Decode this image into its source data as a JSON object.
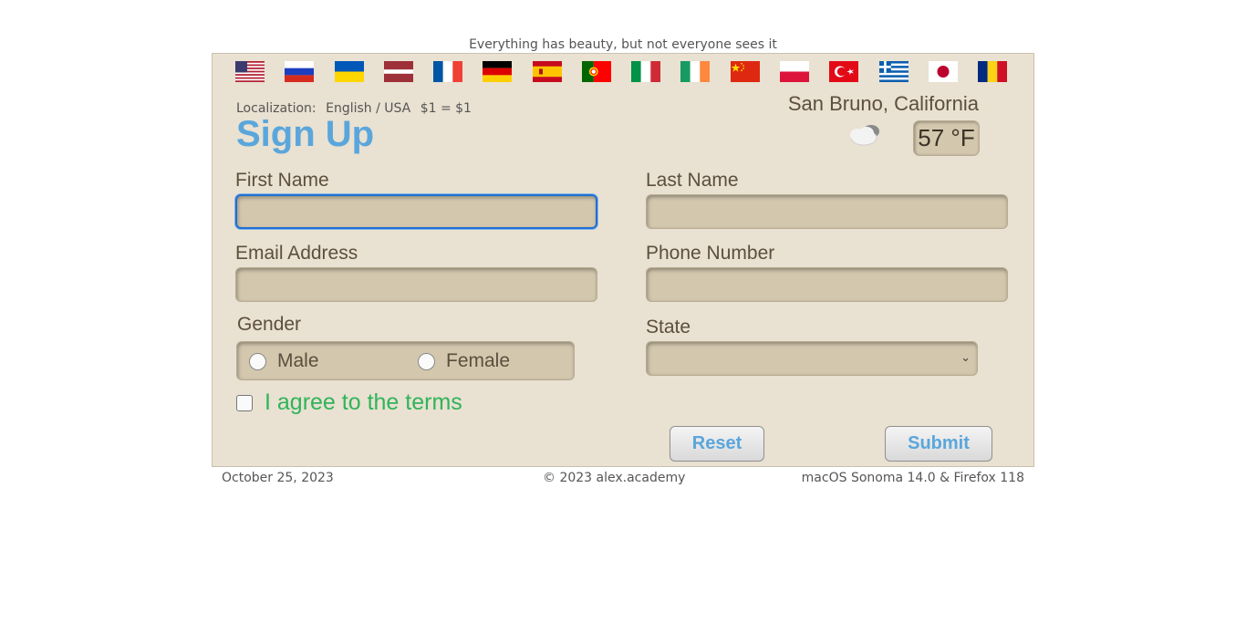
{
  "tagline": "Everything has beauty, but not everyone sees it",
  "flags": [
    {
      "name": "flag-usa"
    },
    {
      "name": "flag-russia"
    },
    {
      "name": "flag-ukraine"
    },
    {
      "name": "flag-latvia"
    },
    {
      "name": "flag-france"
    },
    {
      "name": "flag-germany"
    },
    {
      "name": "flag-spain"
    },
    {
      "name": "flag-portugal"
    },
    {
      "name": "flag-italy"
    },
    {
      "name": "flag-ireland"
    },
    {
      "name": "flag-china"
    },
    {
      "name": "flag-poland"
    },
    {
      "name": "flag-turkey"
    },
    {
      "name": "flag-greece"
    },
    {
      "name": "flag-japan"
    },
    {
      "name": "flag-romania"
    }
  ],
  "localization": {
    "label": "Localization:",
    "value": "English / USA",
    "currency": "$1 = $1"
  },
  "form_title": "Sign Up",
  "weather": {
    "city": "San Bruno, California",
    "icon": "cloud-icon",
    "temperature": "57 °F"
  },
  "fields": {
    "first_name": {
      "label": "First Name",
      "value": ""
    },
    "last_name": {
      "label": "Last Name",
      "value": ""
    },
    "email": {
      "label": "Email Address",
      "value": ""
    },
    "phone": {
      "label": "Phone Number",
      "value": ""
    }
  },
  "gender": {
    "label": "Gender",
    "options": [
      "Male",
      "Female"
    ]
  },
  "state": {
    "label": "State",
    "selected": ""
  },
  "agree_label": "I agree to the terms",
  "buttons": {
    "reset": "Reset",
    "submit": "Submit"
  },
  "footer": {
    "date": "October 25, 2023",
    "copyright": "© 2023 alex.academy",
    "platform": "macOS Sonoma 14.0 & Firefox 118"
  },
  "colors": {
    "panel_bg": "#e9e1d1",
    "field_bg": "#d3c7ae",
    "title": "#5aa6dc",
    "agree": "#2fb45a",
    "focus": "#1f6fd1"
  }
}
